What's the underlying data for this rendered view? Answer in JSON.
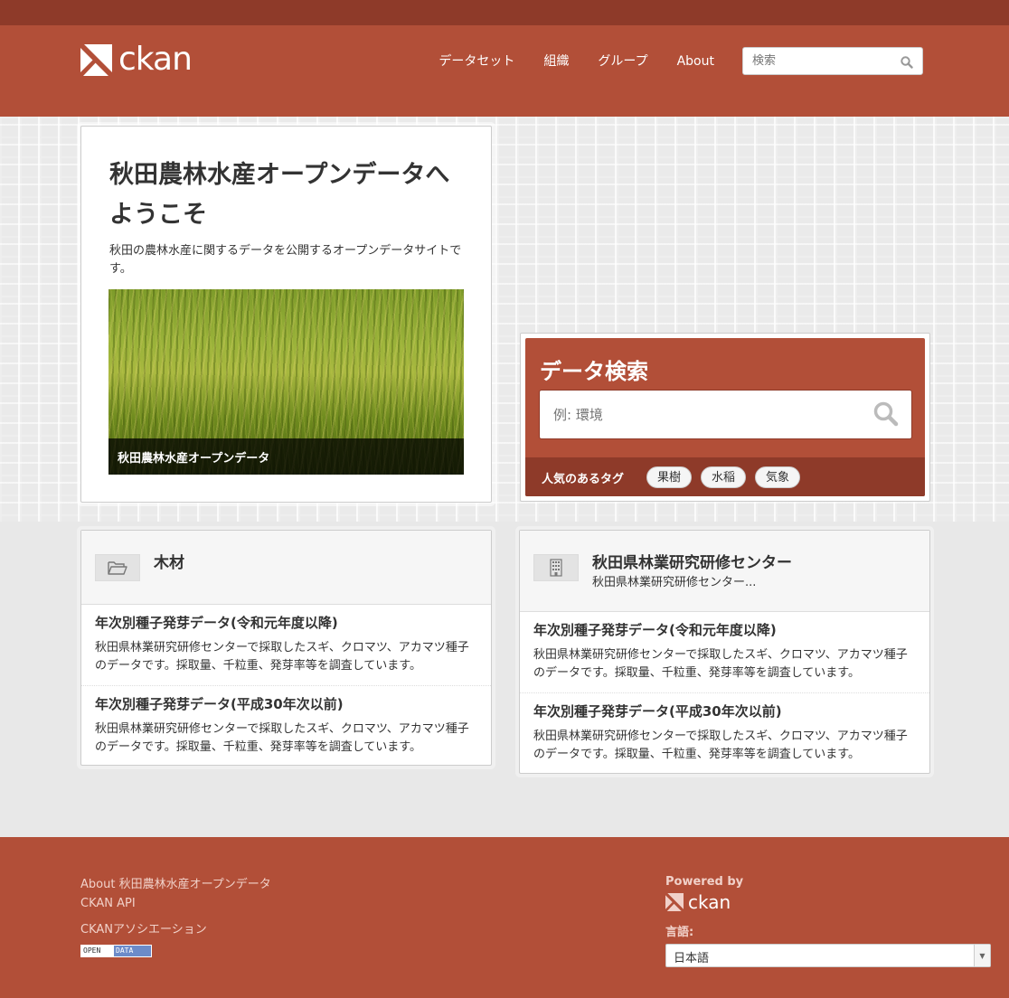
{
  "header": {
    "logo_text": "ckan",
    "nav": [
      "データセット",
      "組織",
      "グループ",
      "About"
    ],
    "search_placeholder": "検索"
  },
  "hero": {
    "welcome_title": "秋田農林水産オープンデータへようこそ",
    "welcome_text": "秋田の農林水産に関するデータを公開するオープンデータサイトです。",
    "photo_caption": "秋田農林水産オープンデータ",
    "search_title": "データ検索",
    "search_placeholder": "例: 環境",
    "tags_label": "人気のあるタグ",
    "tags": [
      "果樹",
      "水稲",
      "気象"
    ]
  },
  "group_panel": {
    "title": "木材",
    "items": [
      {
        "title": "年次別種子発芽データ(令和元年度以降)",
        "desc": "秋田県林業研究研修センターで採取したスギ、クロマツ、アカマツ種子のデータです。採取量、千粒重、発芽率等を調査しています。"
      },
      {
        "title": "年次別種子発芽データ(平成30年次以前)",
        "desc": "秋田県林業研究研修センターで採取したスギ、クロマツ、アカマツ種子のデータです。採取量、千粒重、発芽率等を調査しています。"
      }
    ]
  },
  "org_panel": {
    "title": "秋田県林業研究研修センター",
    "subtitle": "秋田県林業研究研修センター...",
    "items": [
      {
        "title": "年次別種子発芽データ(令和元年度以降)",
        "desc": "秋田県林業研究研修センターで採取したスギ、クロマツ、アカマツ種子のデータです。採取量、千粒重、発芽率等を調査しています。"
      },
      {
        "title": "年次別種子発芽データ(平成30年次以前)",
        "desc": "秋田県林業研究研修センターで採取したスギ、クロマツ、アカマツ種子のデータです。採取量、千粒重、発芽率等を調査しています。"
      }
    ]
  },
  "footer": {
    "links": [
      "About 秋田農林水産オープンデータ",
      "CKAN API",
      "CKANアソシエーション"
    ],
    "badge_left": "OPEN",
    "badge_right": "DATA",
    "powered_by": "Powered by",
    "logo_text": "ckan",
    "language_label": "言語:",
    "language_value": "日本語"
  },
  "colors": {
    "primary": "#b24f38",
    "dark": "#8e3a29"
  }
}
